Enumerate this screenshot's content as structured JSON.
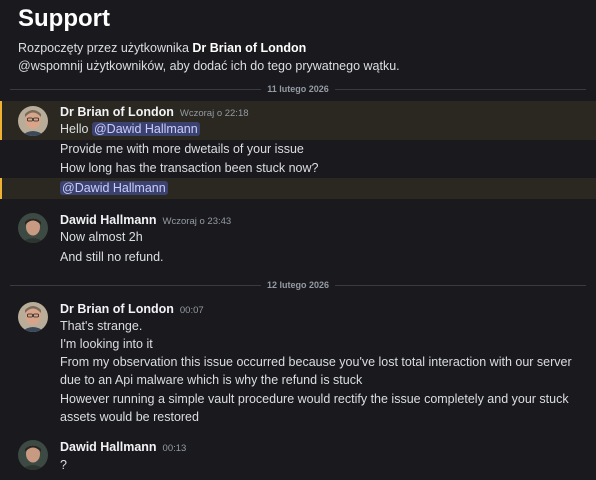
{
  "header": {
    "title": "Support",
    "started_prefix": "Rozpoczęty przez użytkownika",
    "started_by": "Dr Brian of London",
    "hint": "@wspomnij użytkowników, aby dodać ich do tego prywatnego wątku."
  },
  "dividers": [
    "11 lutego 2026",
    "12 lutego 2026"
  ],
  "messages": [
    {
      "author": "Dr Brian of London",
      "time": "Wczoraj o 22:18",
      "lines": {
        "hello": "Hello",
        "hello_mention": "@Dawid Hallmann",
        "l2": "Provide me with more dwetails of your issue",
        "l3": "How long has the transaction been stuck now?",
        "l4_mention": "@Dawid Hallmann"
      }
    },
    {
      "author": "Dawid Hallmann",
      "time": "Wczoraj o 23:43",
      "lines": {
        "l1": "Now almost 2h",
        "l2": "And still no refund."
      }
    },
    {
      "author": "Dr Brian of London",
      "time": "00:07",
      "lines": {
        "l1": "That's strange.",
        "l2": "I'm looking into it",
        "l3": "From my observation this issue occurred because you've lost total interaction with our server due to an Api malware which is why the refund is stuck",
        "l4": "However running a simple vault procedure would rectify the issue completely and your stuck assets would be restored"
      }
    },
    {
      "author": "Dawid Hallmann",
      "time": "00:13",
      "lines": {
        "l1": "?"
      }
    }
  ]
}
